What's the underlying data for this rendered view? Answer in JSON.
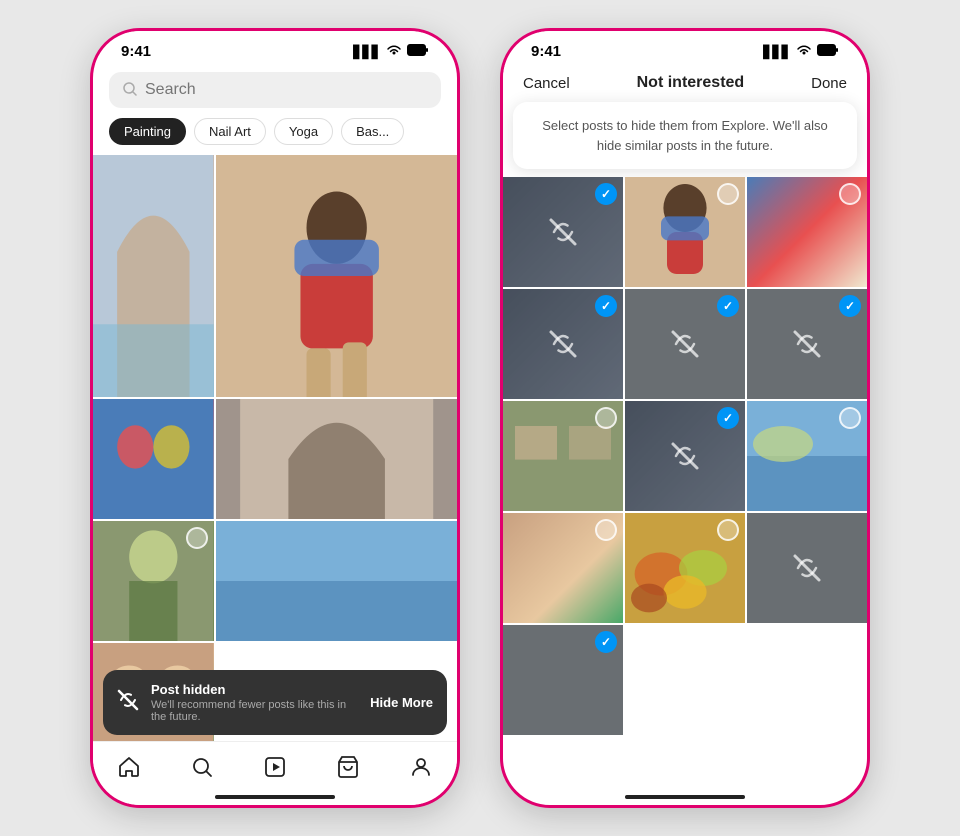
{
  "left_phone": {
    "status_bar": {
      "time": "9:41",
      "signal": "▋▋▋",
      "wifi": "WiFi",
      "battery": "🔋"
    },
    "search": {
      "placeholder": "Search"
    },
    "chips": [
      {
        "label": "Painting",
        "active": true
      },
      {
        "label": "Nail Art",
        "active": false
      },
      {
        "label": "Yoga",
        "active": false
      },
      {
        "label": "Bas...",
        "active": false
      }
    ],
    "snackbar": {
      "title": "Post hidden",
      "subtitle": "We'll recommend fewer posts like this in the future.",
      "button": "Hide More"
    },
    "nav_icons": [
      "🏠",
      "🔍",
      "🎬",
      "🛍",
      "👤"
    ]
  },
  "right_phone": {
    "status_bar": {
      "time": "9:41"
    },
    "top_bar": {
      "cancel": "Cancel",
      "title": "Not interested",
      "done": "Done"
    },
    "tooltip": {
      "text": "Select posts to hide them from Explore. We'll also hide similar posts in the future."
    }
  },
  "colors": {
    "brand": "#e0006e",
    "blue_check": "#0095f6",
    "snackbar_bg": "#333333"
  }
}
